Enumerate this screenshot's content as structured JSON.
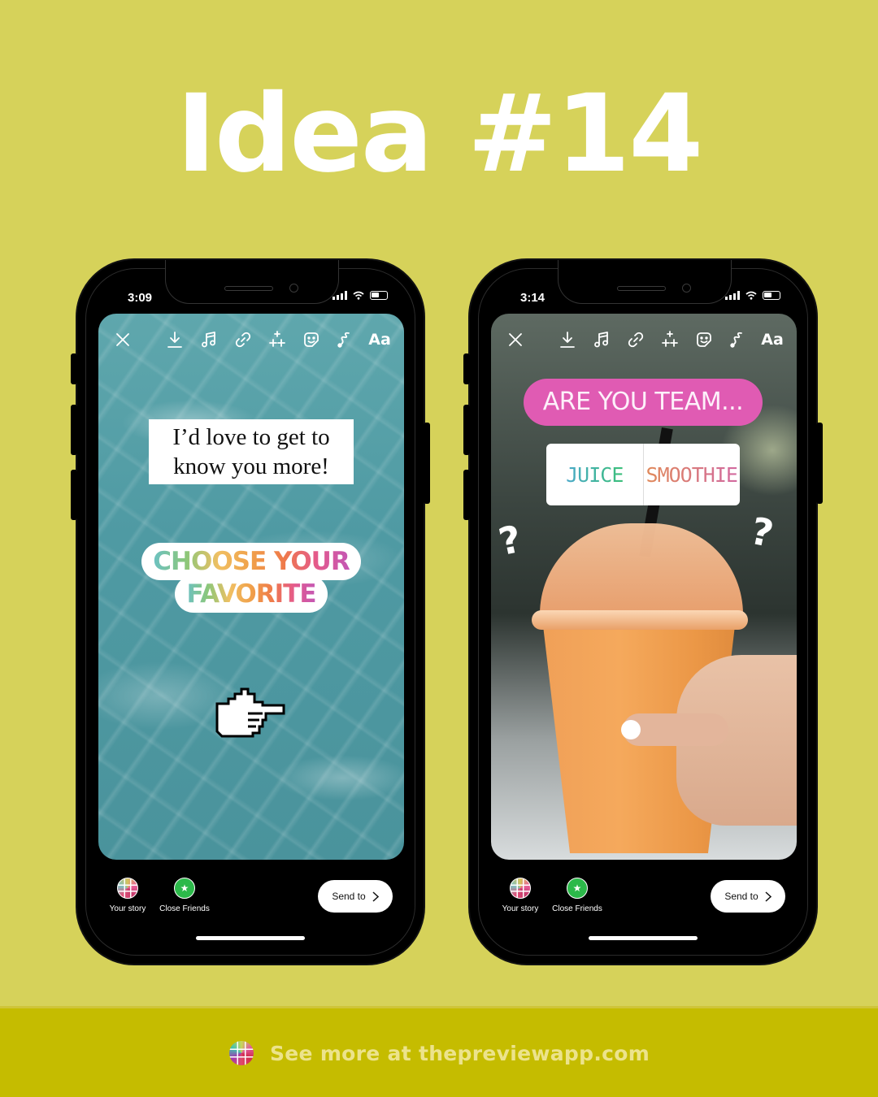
{
  "headline": "Idea #14",
  "phones": [
    {
      "status": {
        "time": "3:09"
      },
      "toolbar": {
        "close": "close-icon",
        "download": "download-icon",
        "music": "music-icon",
        "link": "link-icon",
        "effects": "sparkles-icon",
        "sticker": "sticker-icon",
        "draw": "draw-icon",
        "text_label": "Aa"
      },
      "text_card": {
        "line1": "I’d love to get to",
        "line2": "know you more!"
      },
      "sticker": {
        "line1": "CHOOSE YOUR",
        "line2": "FAVORITE"
      },
      "pointer": "pointing-hand-icon",
      "bottom": {
        "your_story": "Your story",
        "close_friends": "Close Friends",
        "send_to": "Send to"
      }
    },
    {
      "status": {
        "time": "3:14"
      },
      "toolbar": {
        "close": "close-icon",
        "download": "download-icon",
        "music": "music-icon",
        "link": "link-icon",
        "effects": "sparkles-icon",
        "sticker": "sticker-icon",
        "draw": "draw-icon",
        "text_label": "Aa"
      },
      "question": "ARE YOU TEAM...",
      "poll": {
        "option1": "JUICE",
        "option2": "SMOOTHIE"
      },
      "question_marks": [
        "?",
        "?"
      ],
      "bottom": {
        "your_story": "Your story",
        "close_friends": "Close Friends",
        "send_to": "Send to"
      }
    }
  ],
  "footer": {
    "text": "See more at thepreviewapp.com"
  },
  "colors": {
    "background": "#d6d25a",
    "footer": "#c5bc00",
    "footer_text": "#ece38c",
    "question_pill": "#e05bb3",
    "close_friends": "#2cb94a"
  }
}
